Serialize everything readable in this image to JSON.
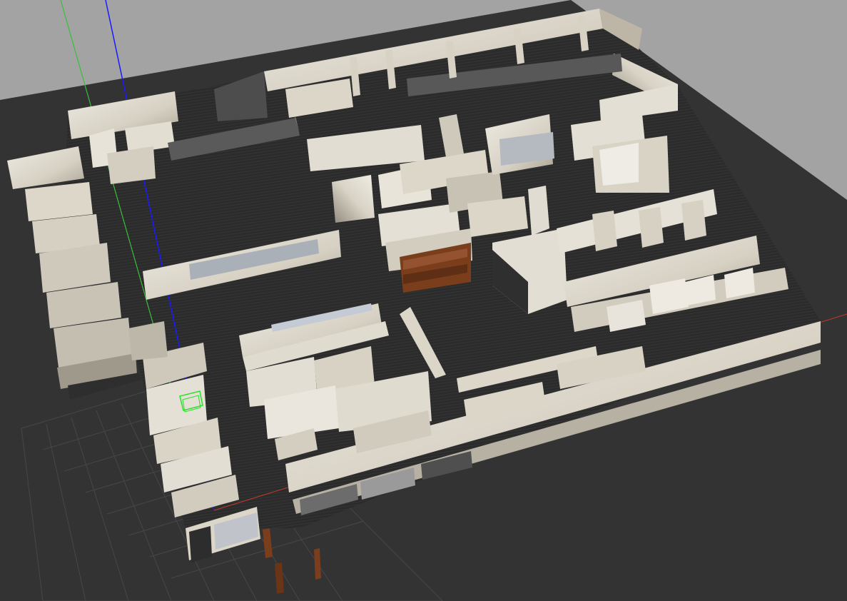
{
  "scene": {
    "type": "3d-simulator-viewport",
    "subject": "office-floor-plan-world",
    "colors": {
      "sky": "#a3a3a3",
      "ground": "#333333",
      "floor_dark": "#2a2a2a",
      "wall_light": "#e6e1d6",
      "wall_mid": "#cbc5b7",
      "wall_shadow": "#9c968a",
      "grid_line": "#4a4a4a",
      "axis_x": "#c43a2a",
      "axis_y": "#38c038",
      "axis_z": "#1a1aff",
      "selection": "#29e029",
      "furniture_wood": "#7a3e1c"
    },
    "icons": {
      "origin_axes": "axes-icon",
      "selected_model": "selection-box-icon"
    }
  }
}
